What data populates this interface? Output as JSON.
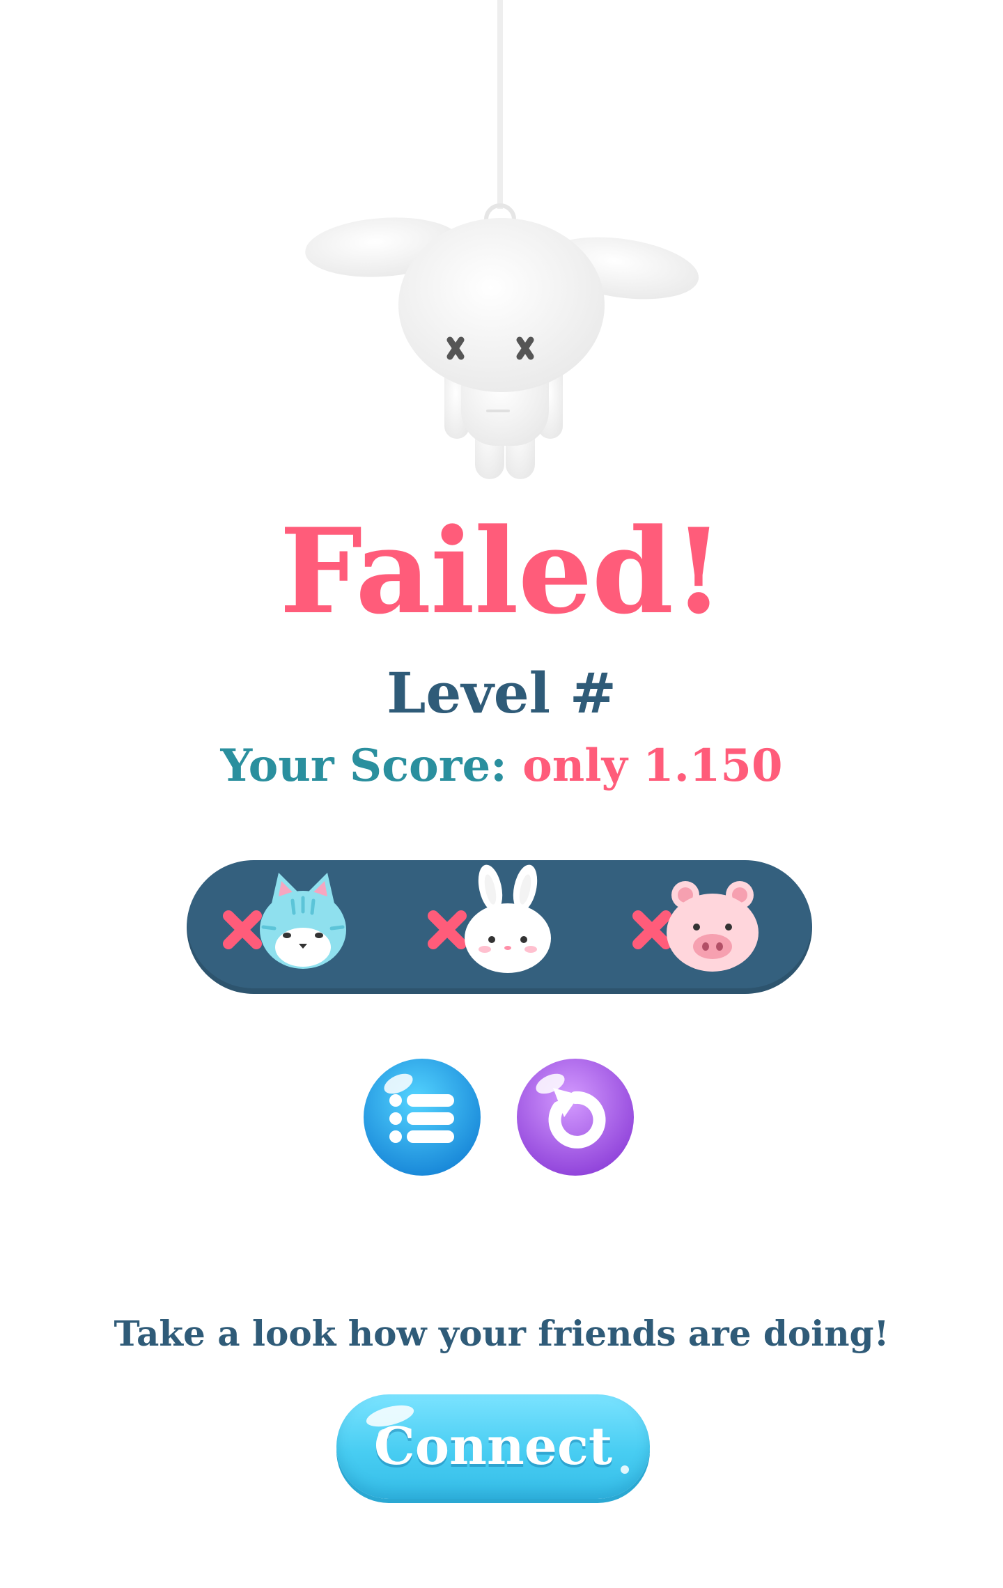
{
  "result": {
    "title": "Failed!",
    "level_label": "Level #",
    "score_label": "Your Score:",
    "score_value": "only 1.150"
  },
  "goals": [
    {
      "animal": "cat",
      "icon": "cat-face-icon",
      "status_icon": "x-mark-icon"
    },
    {
      "animal": "bunny",
      "icon": "bunny-face-icon",
      "status_icon": "x-mark-icon"
    },
    {
      "animal": "pig",
      "icon": "pig-face-icon",
      "status_icon": "x-mark-icon"
    }
  ],
  "buttons": {
    "menu_icon": "list-menu-icon",
    "retry_icon": "retry-arrow-icon"
  },
  "friends": {
    "prompt": "Take a look how your friends are doing!",
    "connect_label": "Connect"
  },
  "colors": {
    "fail_pink": "#ff5c7a",
    "navy": "#2f5b78",
    "teal": "#2a8f9e",
    "panel": "#34607e",
    "menu_blue": "#1ea6e6",
    "retry_purple": "#a54fe6",
    "connect_cyan": "#48cdf2"
  }
}
